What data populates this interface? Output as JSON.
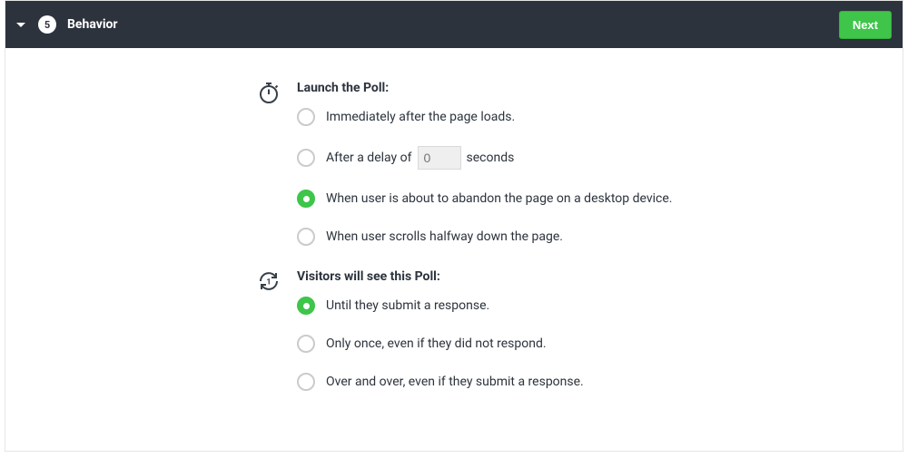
{
  "header": {
    "step_number": "5",
    "title": "Behavior",
    "next_label": "Next"
  },
  "launch": {
    "heading": "Launch the Poll:",
    "opt_immediate": "Immediately after the page loads.",
    "opt_delay_prefix": "After a delay of",
    "opt_delay_value": "0",
    "opt_delay_suffix": "seconds",
    "opt_abandon": "When user is about to abandon the page on a desktop device.",
    "opt_scroll": "When user scrolls halfway down the page."
  },
  "visitors": {
    "heading": "Visitors will see this Poll:",
    "opt_until_submit": "Until they submit a response.",
    "opt_only_once": "Only once, even if they did not respond.",
    "opt_over_and_over": "Over and over, even if they submit a response."
  }
}
